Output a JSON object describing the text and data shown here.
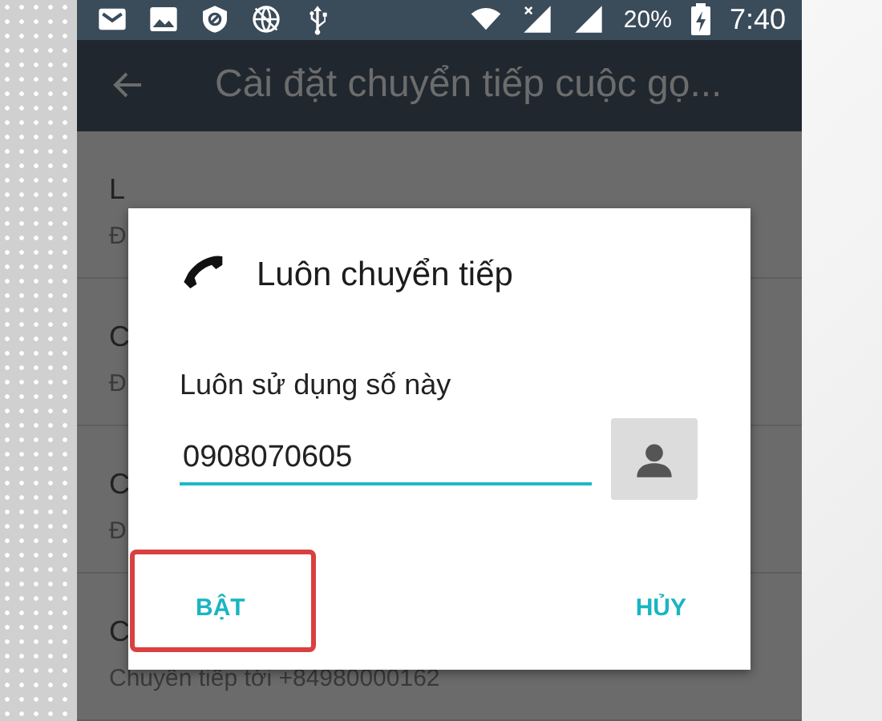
{
  "status_bar": {
    "battery": "20%",
    "time": "7:40"
  },
  "app_bar": {
    "title": "Cài đặt chuyển tiếp cuộc gọ..."
  },
  "list": [
    {
      "title": "L",
      "subtitle": "Đ"
    },
    {
      "title": "C",
      "subtitle": "Đ"
    },
    {
      "title": "C",
      "subtitle": "Đ"
    },
    {
      "title": "C",
      "subtitle": "Chuyển tiếp tới +84980000162"
    }
  ],
  "dialog": {
    "title": "Luôn chuyển tiếp",
    "label": "Luôn sử dụng số này",
    "value": "0908070605",
    "buttons": [
      {
        "label": "BẬT",
        "highlighted": true
      },
      {
        "label": "HỦY",
        "highlighted": false
      }
    ]
  }
}
